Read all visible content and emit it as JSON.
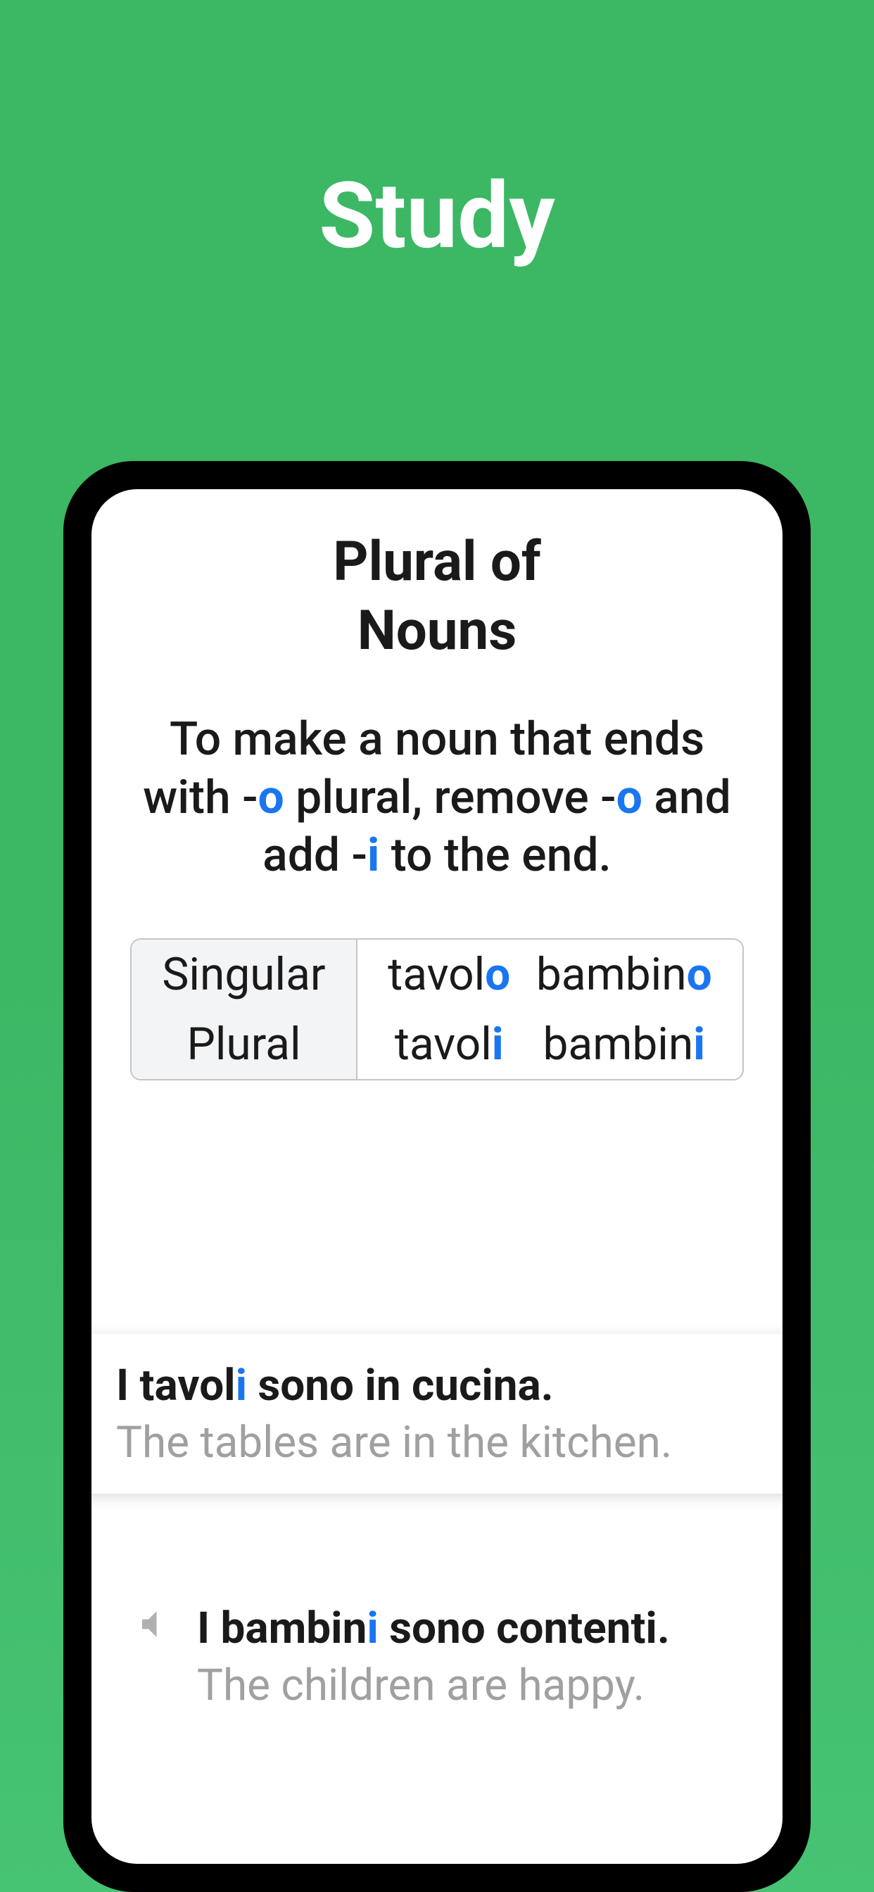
{
  "page_title": "Study",
  "lesson": {
    "title_line1": "Plural of",
    "title_line2": "Nouns",
    "desc_part1": "To make a noun that ends with -",
    "desc_hl1": "o",
    "desc_part2": " plural, remove -",
    "desc_hl2": "o",
    "desc_part3": " and add -",
    "desc_hl3": "i",
    "desc_part4": " to the end."
  },
  "table": {
    "row1_label": "Singular",
    "row1_word1_base": "tavol",
    "row1_word1_end": "o",
    "row1_word2_base": "bambin",
    "row1_word2_end": "o",
    "row2_label": "Plural",
    "row2_word1_base": "tavol",
    "row2_word1_end": "i",
    "row2_word2_base": "bambin",
    "row2_word2_end": "i"
  },
  "example1": {
    "it_part1": "I tavol",
    "it_hl": "i",
    "it_part2": " sono in cucina.",
    "en": "The tables are in the kitchen."
  },
  "example2": {
    "it_part1": "I bambin",
    "it_hl": "i",
    "it_part2": " sono contenti.",
    "en": "The children are happy."
  }
}
